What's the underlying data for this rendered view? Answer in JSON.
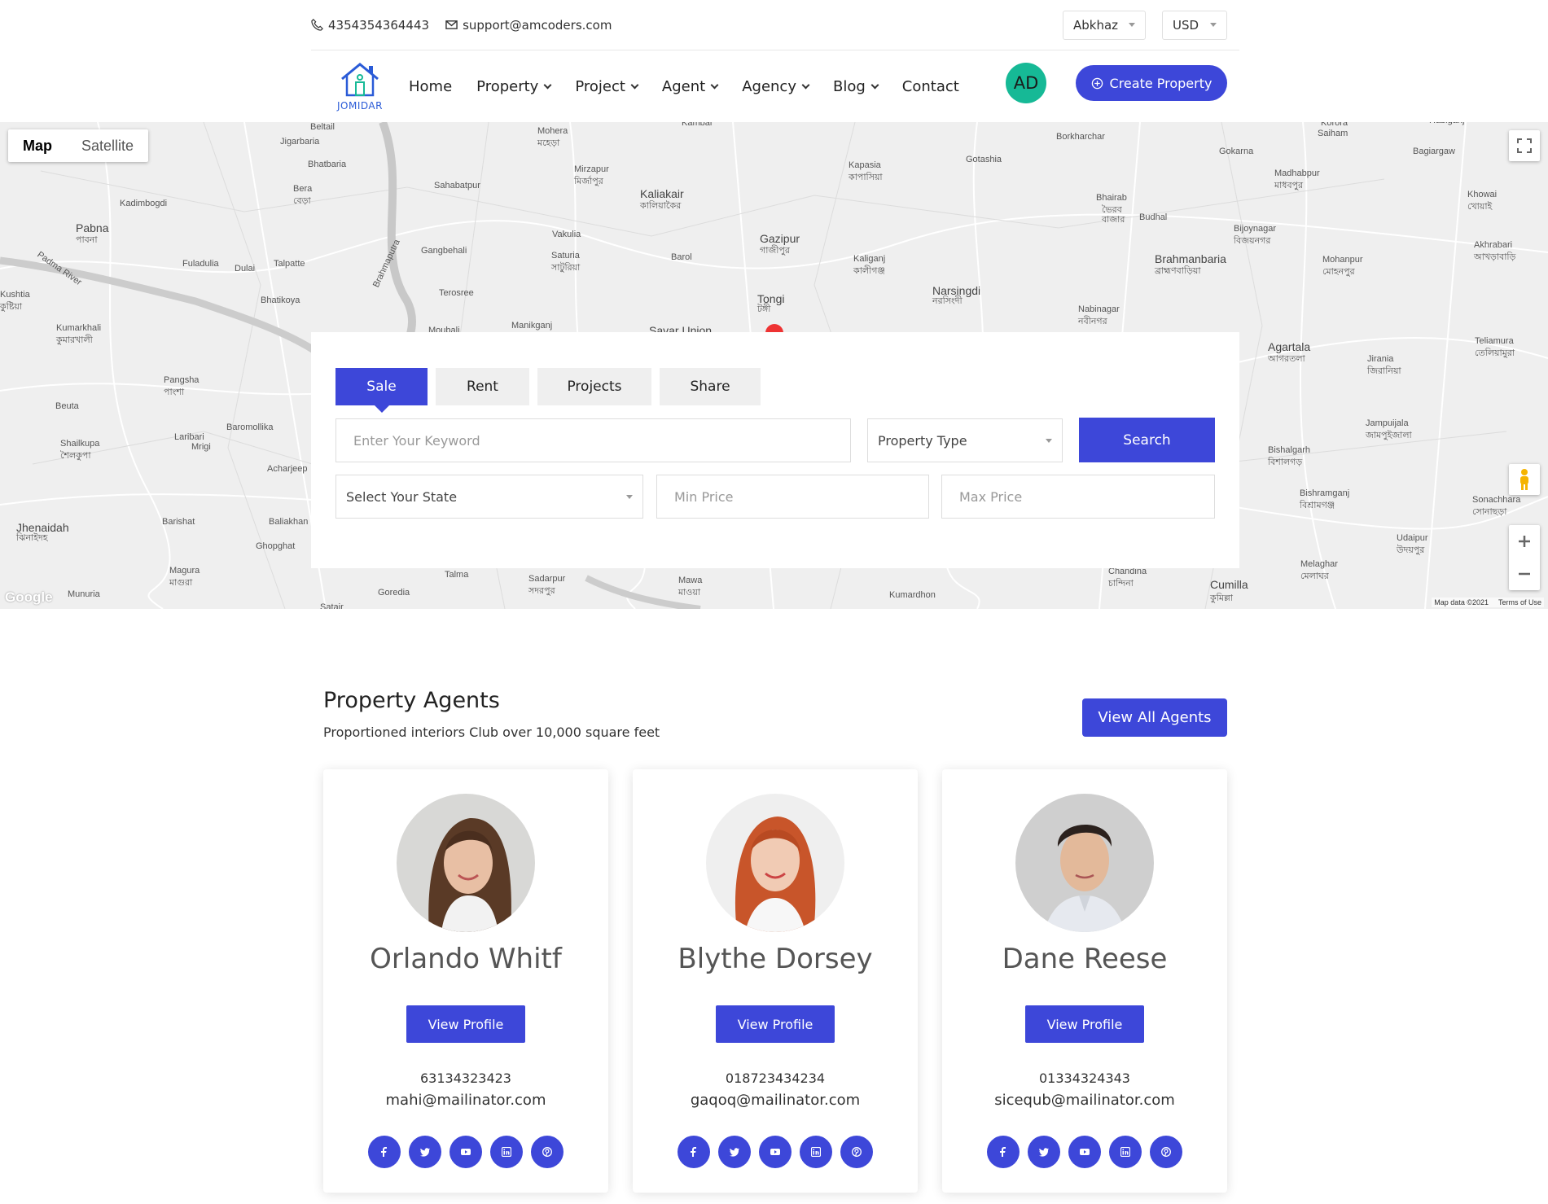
{
  "topbar": {
    "phone": "4354354364443",
    "email": "support@amcoders.com",
    "language": "Abkhaz",
    "currency": "USD"
  },
  "logo": {
    "text": "JOMIDAR"
  },
  "nav": {
    "items": [
      {
        "label": "Home",
        "dropdown": false
      },
      {
        "label": "Property",
        "dropdown": true
      },
      {
        "label": "Project",
        "dropdown": true
      },
      {
        "label": "Agent",
        "dropdown": true
      },
      {
        "label": "Agency",
        "dropdown": true
      },
      {
        "label": "Blog",
        "dropdown": true
      },
      {
        "label": "Contact",
        "dropdown": false
      }
    ],
    "avatar_initials": "AD",
    "create_label": "Create Property"
  },
  "map": {
    "type_buttons": [
      "Map",
      "Satellite"
    ],
    "active_type": "Map",
    "footer": {
      "data": "Map data ©2021",
      "terms": "Terms of Use"
    },
    "google": "Google",
    "labels": [
      "Beltail",
      "Jigarbaria",
      "Mohera",
      "মহেড়া",
      "Kambai",
      "Borkharchar",
      "Korora",
      "Saiham",
      "Bagiargaw",
      "Habiganj",
      "Bhatbaria",
      "Sahabatpur",
      "Mirzapur",
      "মির্জাপুর",
      "Kapasia",
      "কাপাসিয়া",
      "Gotashia",
      "Gokarna",
      "Madhabpur",
      "মাধবপুর",
      "Khowai",
      "খোয়াই",
      "Bera",
      "বেড়া",
      "Kadimbogdi",
      "Kaliakair",
      "কালিয়াকৈর",
      "Bhairab",
      "ভৈরব",
      "বাজার",
      "Budhal",
      "Pabna",
      "পাবনা",
      "Brahmaputra",
      "Vakulia",
      "Gazipur",
      "গাজীপুর",
      "Bijoynagar",
      "বিজয়নগর",
      "Akhrabari",
      "আখড়াবাড়ি",
      "Padma River",
      "Fuladulia",
      "Dulai",
      "Talpatte",
      "Gangbehali",
      "Saturia",
      "সাটুরিয়া",
      "Barol",
      "Kaliganj",
      "কালীগঞ্জ",
      "Brahmanbaria",
      "ব্রাহ্মণবাড়িয়া",
      "Mohanpur",
      "মোহনপুর",
      "Kushtia",
      "কুষ্টিয়া",
      "Bhatikoya",
      "Terosree",
      "Tongi",
      "টঙ্গী",
      "Narsingdi",
      "নরসিংদী",
      "Nabinagar",
      "নবীনগর",
      "Kumarkhali",
      "কুমারখালী",
      "Manikganj",
      "Savar Union",
      "Moubali",
      "Agartala",
      "আগরতলা",
      "Teliamura",
      "তেলিয়ামুরা",
      "Jirania",
      "জিরানিয়া",
      "Pangsha",
      "পাংশা",
      "Beuta",
      "Baromollika",
      "Jampuijala",
      "জামপুইজালা",
      "Laribari",
      "Mrigi",
      "Shailkupa",
      "শৈলকুপা",
      "Bishalgarh",
      "বিশালগড়",
      "Acharjeep",
      "Jhenaidah",
      "ঝিনাইদহ",
      "Barishat",
      "Baliakhan",
      "Bishramganj",
      "বিশ্রামগঞ্জ",
      "Sonachhara",
      "সোনাছড়া",
      "Ghopghat",
      "Udaipur",
      "উদয়পুর",
      "Magura",
      "মাগুরা",
      "Talma",
      "Sadarpur",
      "সদরপুর",
      "Mawa",
      "মাওয়া",
      "Chandina",
      "চান্দিনা",
      "Melaghar",
      "মেলাঘর",
      "Munuria",
      "Goredia",
      "Kumardhon",
      "Cumilla",
      "কুমিল্লা",
      "Satair"
    ]
  },
  "search": {
    "tabs": [
      "Sale",
      "Rent",
      "Projects",
      "Share"
    ],
    "active_tab": "Sale",
    "keyword_placeholder": "Enter Your Keyword",
    "property_type": "Property Type",
    "search_label": "Search",
    "state": "Select Your State",
    "min_price_placeholder": "Min Price",
    "max_price_placeholder": "Max Price"
  },
  "agents_section": {
    "title": "Property Agents",
    "subtitle": "Proportioned interiors Club over 10,000 square feet",
    "view_all": "View All Agents",
    "profile_label": "View Profile",
    "agents": [
      {
        "name": "Orlando Whitf",
        "phone": "63134323423",
        "email": "mahi@mailinator.com"
      },
      {
        "name": "Blythe Dorsey",
        "phone": "018723434234",
        "email": "gaqoq@mailinator.com"
      },
      {
        "name": "Dane Reese",
        "phone": "01334324343",
        "email": "sicequb@mailinator.com"
      }
    ],
    "social_icons": [
      "facebook-icon",
      "twitter-icon",
      "youtube-icon",
      "linkedin-icon",
      "pinterest-icon"
    ]
  },
  "colors": {
    "accent": "#3d47d9",
    "avatar": "#16b996",
    "map_bg": "#efefef"
  }
}
